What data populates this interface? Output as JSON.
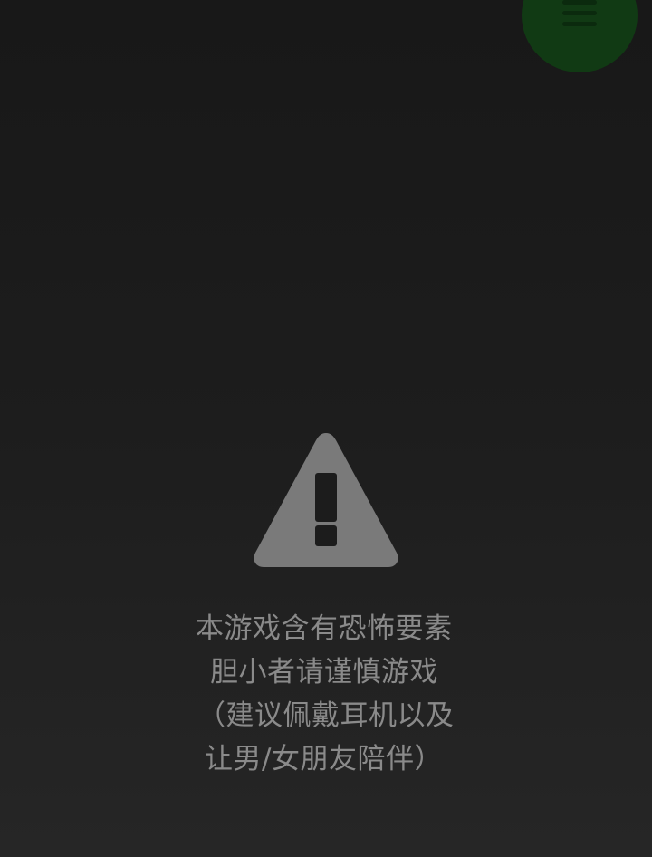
{
  "menu": {
    "icon": "menu-icon",
    "color": "#113a14"
  },
  "warning": {
    "icon": "warning-triangle-icon",
    "lines": [
      "本游戏含有恐怖要素",
      "胆小者请谨慎游戏",
      "（建议佩戴耳机以及",
      "让男/女朋友陪伴）"
    ]
  }
}
